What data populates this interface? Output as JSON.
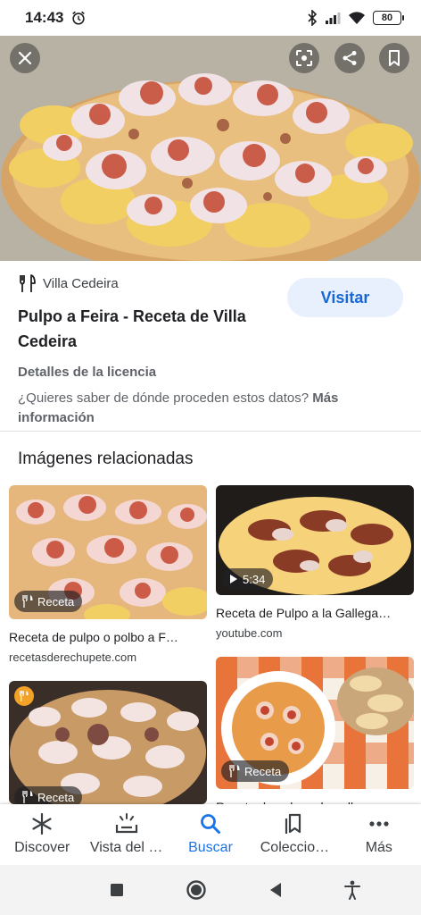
{
  "status_bar": {
    "time": "14:43",
    "battery": "80"
  },
  "hero": {
    "icons": [
      "close-icon",
      "lens-icon",
      "share-icon",
      "bookmark-icon"
    ]
  },
  "result": {
    "source_name": "Villa Cedeira",
    "title": "Pulpo a Feira - Receta de Villa Cedeira",
    "visit_label": "Visitar",
    "license_heading": "Detalles de la licencia",
    "license_question": "¿Quieres saber de dónde proceden estos datos?",
    "license_more": "Más información"
  },
  "related": {
    "heading": "Imágenes relacionadas",
    "cards": [
      {
        "badge": "Receta",
        "title": "Receta de pulpo o polbo a F…",
        "domain": "recetasderechupete.com"
      },
      {
        "badge": "5:34",
        "title": "Receta de Pulpo a la Gallega…",
        "domain": "youtube.com"
      },
      {
        "badge": "Receta",
        "title": "Receta de pulpo a la gallega…",
        "domain": ""
      },
      {
        "badge": "Receta",
        "title": "",
        "domain": ""
      }
    ]
  },
  "bottom_nav": [
    {
      "label": "Discover",
      "icon": "asterisk-icon"
    },
    {
      "label": "Vista del …",
      "icon": "snapshot-icon"
    },
    {
      "label": "Buscar",
      "icon": "search-icon"
    },
    {
      "label": "Coleccio…",
      "icon": "collections-icon"
    },
    {
      "label": "Más",
      "icon": "more-icon"
    }
  ],
  "colors": {
    "accent": "#1a73e8",
    "visit_bg": "#e8f0fe",
    "paprika": "#c4452f",
    "potato": "#f0c75a"
  }
}
